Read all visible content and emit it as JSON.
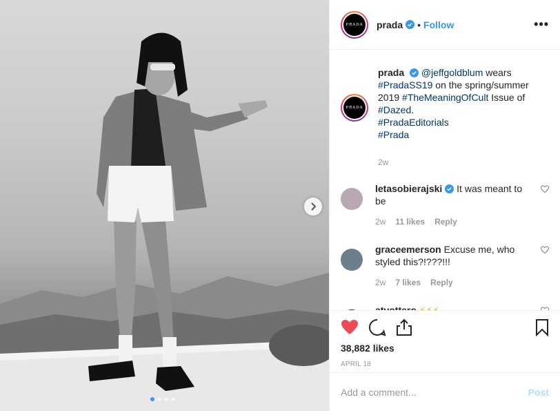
{
  "header": {
    "avatar_text": "PRADA",
    "username": "prada",
    "separator": "•",
    "follow_label": "Follow",
    "more_label": "•••"
  },
  "caption": {
    "username": "prada",
    "parts": [
      {
        "text": "@jeffgoldblum",
        "link": true
      },
      {
        "text": " wears ",
        "link": false
      },
      {
        "text": "#PradaSS19",
        "link": true
      },
      {
        "text": " on the spring/summer 2019 ",
        "link": false
      },
      {
        "text": "#TheMeaningOfCult",
        "link": true
      },
      {
        "text": " Issue of ",
        "link": false
      },
      {
        "text": "#Dazed",
        "link": true
      },
      {
        "text": ".",
        "link": false
      },
      {
        "text": "#PradaEditorials",
        "link": true,
        "newline": true
      },
      {
        "text": "#Prada",
        "link": true,
        "newline": true
      }
    ],
    "time": "2w"
  },
  "comments": [
    {
      "username": "letasobierajski",
      "verified": true,
      "text": "It was meant to be",
      "time": "2w",
      "likes": "11 likes",
      "reply": "Reply",
      "avatar_color": "#b9a7b4"
    },
    {
      "username": "graceemerson",
      "verified": false,
      "text": "Excuse me, who styled this?!???!!!",
      "time": "2w",
      "likes": "7 likes",
      "reply": "Reply",
      "avatar_color": "#6d7f8a"
    },
    {
      "username": "atvottero",
      "verified": false,
      "text": "⚡⚡⚡",
      "time": "",
      "likes": "",
      "reply": "",
      "avatar_color": "#2b2b2b"
    }
  ],
  "actions": {
    "likes": "38,882 likes",
    "date": "APRIL 18"
  },
  "add_comment": {
    "placeholder": "Add a comment...",
    "post_label": "Post"
  },
  "carousel": {
    "dot_count": 4,
    "active_index": 0
  },
  "colors": {
    "accent": "#3897f0",
    "like_red": "#ed4956",
    "link": "#003569"
  }
}
